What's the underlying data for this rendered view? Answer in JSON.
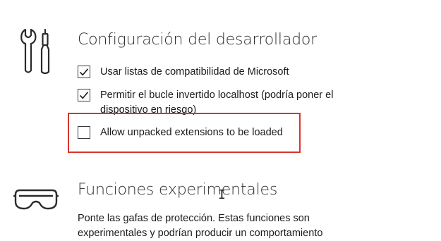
{
  "developer_settings": {
    "title": "Configuración del desarrollador",
    "icon": "wrench-screwdriver-icon",
    "options": [
      {
        "label": "Usar listas de compatibilidad de Microsoft",
        "checked": true
      },
      {
        "label": "Permitir el bucle invertido localhost (podría poner el dispositivo en riesgo)",
        "checked": true
      },
      {
        "label": "Allow unpacked extensions to be loaded",
        "checked": false
      }
    ],
    "highlight_color": "#d9342b"
  },
  "experimental": {
    "title": "Funciones experimentales",
    "icon": "safety-goggles-icon",
    "description": "Ponte las gafas de protección. Estas funciones son experimentales y podrían producir un comportamiento"
  }
}
